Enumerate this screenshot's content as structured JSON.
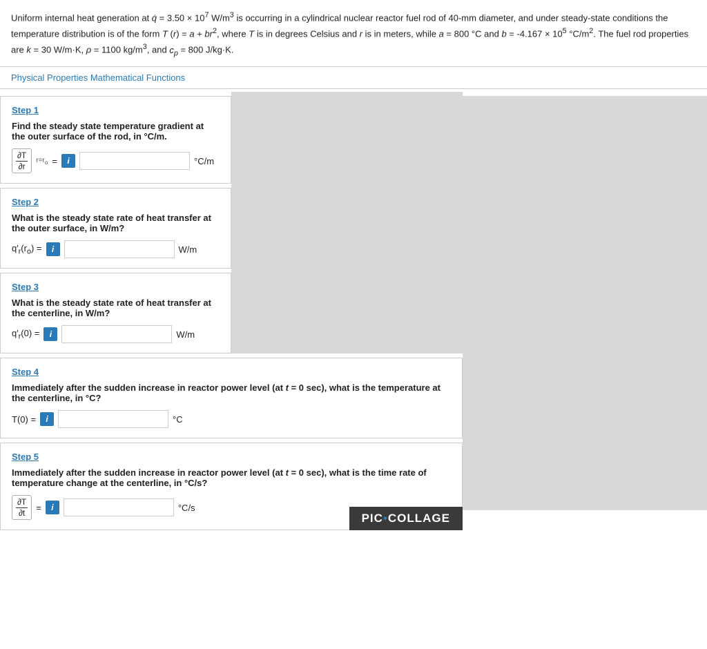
{
  "problem": {
    "text1": "Uniform internal heat generation at ",
    "qdot": "q̇ = 3.50 × 10⁷ W/m³",
    "text2": " is occurring in a cylindrical nuclear reactor fuel rod of 40-mm diameter, and under steady-state conditions the temperature distribution is of the form ",
    "Tfunc": "T (r) = a + br²",
    "text3": ", where T is in degrees Celsius and r is in meters, while ",
    "aval": "a = 800 °C",
    "text4": " and ",
    "bval": "b = -4.167 × 10⁵ °C/m²",
    "text5": ". The fuel rod properties are ",
    "kval": "k = 30 W/m·K,",
    "rho": "ρ = 1100 kg/m³",
    "text6": ", and ",
    "cp": "c_p = 800 J/kg·K",
    "text7": "."
  },
  "phys_link": "Physical Properties Mathematical Functions",
  "steps": [
    {
      "id": "step1",
      "title": "Step 1",
      "question": "Find the steady state temperature gradient at the outer surface of the rod, in °C/m.",
      "label_left": "",
      "label_right": "= i",
      "unit": "°C/m",
      "input_placeholder": ""
    },
    {
      "id": "step2",
      "title": "Step 2",
      "question": "What is the steady state rate of heat transfer at the outer surface, in W/m?",
      "label_left": "q′ᵣ(r₀) =",
      "unit": "W/m",
      "input_placeholder": ""
    },
    {
      "id": "step3",
      "title": "Step 3",
      "question": "What is the steady state rate of heat transfer at the centerline, in W/m?",
      "label_left": "q′ᵣ(0) =",
      "unit": "W/m",
      "input_placeholder": ""
    },
    {
      "id": "step4",
      "title": "Step 4",
      "question": "Immediately after the sudden increase in reactor power level (at t = 0 sec), what is the temperature at the centerline, in °C?",
      "label_left": "T(0) =",
      "unit": "°C",
      "input_placeholder": ""
    },
    {
      "id": "step5",
      "title": "Step 5",
      "question": "Immediately after the sudden increase in reactor power level (at t = 0 sec), what is the time rate of temperature change at the centerline, in °C/s?",
      "label_left": "",
      "unit": "°C/s",
      "input_placeholder": ""
    }
  ],
  "info_button_label": "i",
  "pic_collage": "PIC·COLLAGE"
}
